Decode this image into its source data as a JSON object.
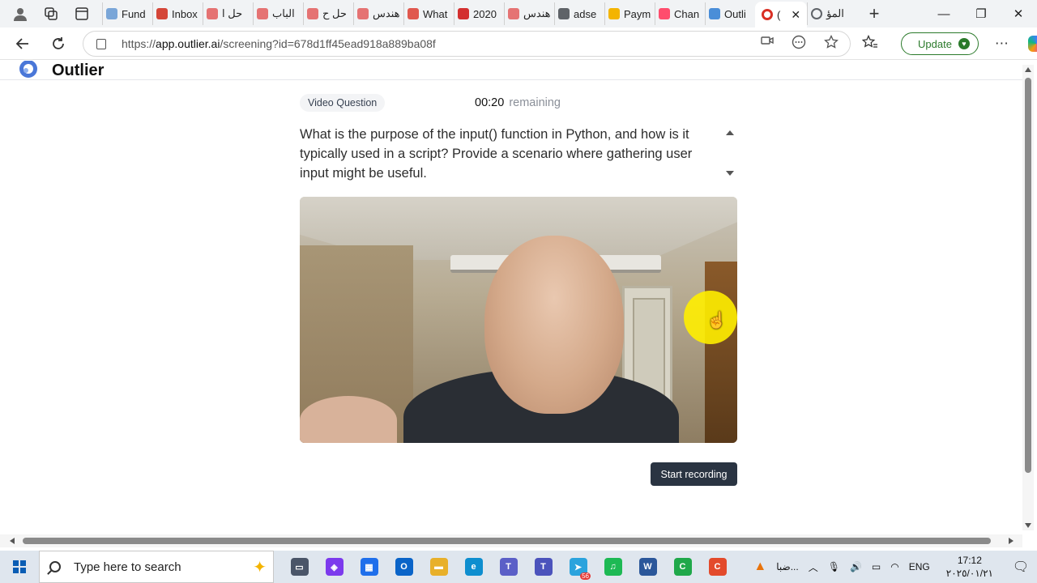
{
  "browser": {
    "tabs": [
      {
        "label": "Fund",
        "color": "#7aa6d8"
      },
      {
        "label": "Inbox",
        "color": "#d44638"
      },
      {
        "label": "حل ا",
        "color": "#e57373"
      },
      {
        "label": "الباب",
        "color": "#e57373"
      },
      {
        "label": "حل ح",
        "color": "#e57373"
      },
      {
        "label": "هندس",
        "color": "#e57373"
      },
      {
        "label": "What",
        "color": "#e0584e"
      },
      {
        "label": "2020",
        "color": "#d32f2f"
      },
      {
        "label": "هندس",
        "color": "#e57373"
      },
      {
        "label": "adse",
        "color": "#5f6368"
      },
      {
        "label": "Paym",
        "color": "#f4b400"
      },
      {
        "label": "Chan",
        "color": "#ff4d6d"
      },
      {
        "label": "Outli",
        "color": "#4a8ed8"
      }
    ],
    "active_tab": {
      "label": "(",
      "color": "#d93025"
    },
    "after_tab": {
      "label": "المؤ",
      "color": "#5f6368"
    },
    "url_prefix": "https://",
    "url_host": "app.outlier.ai",
    "url_path": "/screening?id=678d1ff45ead918a889ba08f",
    "update_label": "Update"
  },
  "app": {
    "logo_text": "Outlier"
  },
  "question": {
    "badge": "Video Question",
    "timer": "00:20",
    "timer_suffix": "remaining",
    "text": "What is the purpose of the input() function in Python, and how is it typically used in a script? Provide a scenario where gathering user input might be useful.",
    "record_label": "Start recording"
  },
  "taskbar": {
    "search_placeholder": "Type here to search",
    "apps": [
      {
        "name": "task-view-icon",
        "color": "#4a5568",
        "glyph": "▭"
      },
      {
        "name": "copilot-icon",
        "color": "#7c3aed",
        "glyph": "◈"
      },
      {
        "name": "store-icon",
        "color": "#1f6feb",
        "glyph": "▦"
      },
      {
        "name": "outlook-icon",
        "color": "#0a64c8",
        "glyph": "O"
      },
      {
        "name": "explorer-icon",
        "color": "#e8b02a",
        "glyph": "▬"
      },
      {
        "name": "edge-icon",
        "color": "#0e8ecf",
        "glyph": "e"
      },
      {
        "name": "teams-icon",
        "color": "#5b5fc7",
        "glyph": "T"
      },
      {
        "name": "teams-work-icon",
        "color": "#4b53bc",
        "glyph": "T"
      },
      {
        "name": "telegram-icon",
        "color": "#2aa3dd",
        "glyph": "➤"
      },
      {
        "name": "spotify-icon",
        "color": "#1db954",
        "glyph": "♫"
      },
      {
        "name": "word-icon",
        "color": "#2b579a",
        "glyph": "W"
      },
      {
        "name": "camtasia-icon",
        "color": "#1fa84a",
        "glyph": "C"
      },
      {
        "name": "camtasia-rec-icon",
        "color": "#e34a2b",
        "glyph": "C"
      }
    ],
    "telegram_badge": "56",
    "weather": "ضبا...",
    "lang": "ENG",
    "time": "17:12",
    "date": "٢٠٢٥/٠١/٢١"
  }
}
